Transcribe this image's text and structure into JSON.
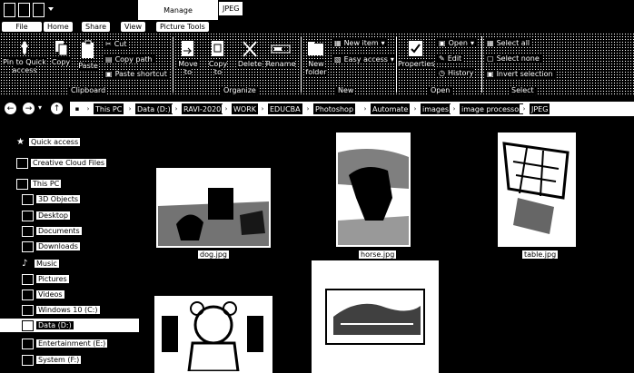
{
  "titlebar": {
    "manage_label": "Manage",
    "folder_title": "JPEG"
  },
  "ribbon_tabs": {
    "file": "File",
    "home": "Home",
    "share": "Share",
    "view": "View",
    "picture_tools": "Picture Tools"
  },
  "ribbon": {
    "pin_to_quick_access": "Pin to Quick access",
    "copy": "Copy",
    "paste": "Paste",
    "cut": "Cut",
    "copy_path": "Copy path",
    "paste_shortcut": "Paste shortcut",
    "move_to": "Move to",
    "copy_to": "Copy to",
    "delete": "Delete",
    "rename": "Rename",
    "new_folder": "New folder",
    "new_item": "New item",
    "easy_access": "Easy access",
    "properties": "Properties",
    "open": "Open",
    "edit": "Edit",
    "history": "History",
    "select_all": "Select all",
    "select_none": "Select none",
    "invert_selection": "Invert selection",
    "groups": {
      "clipboard": "Clipboard",
      "organize": "Organize",
      "new": "New",
      "open": "Open",
      "select": "Select"
    }
  },
  "address": {
    "crumbs": [
      "This PC",
      "Data (D:)",
      "RAVI-2020",
      "WORK",
      "EDUCBA",
      "Photoshop",
      "Automate",
      "images",
      "image processor",
      "JPEG"
    ]
  },
  "nav_pane": {
    "items": [
      {
        "label": "Quick access",
        "icon": "star-icon"
      },
      {
        "label": "Creative Cloud Files",
        "icon": "cloud-icon"
      },
      {
        "label": "This PC",
        "icon": "computer-icon"
      },
      {
        "label": "3D Objects",
        "icon": "cube-icon"
      },
      {
        "label": "Desktop",
        "icon": "desktop-icon"
      },
      {
        "label": "Documents",
        "icon": "document-icon"
      },
      {
        "label": "Downloads",
        "icon": "download-icon"
      },
      {
        "label": "Music",
        "icon": "music-icon"
      },
      {
        "label": "Pictures",
        "icon": "pictures-icon"
      },
      {
        "label": "Videos",
        "icon": "video-icon"
      },
      {
        "label": "Windows 10 (C:)",
        "icon": "drive-icon"
      },
      {
        "label": "Data (D:)",
        "icon": "drive-icon"
      },
      {
        "label": "Entertainment (E:)",
        "icon": "drive-icon"
      },
      {
        "label": "System (F:)",
        "icon": "drive-icon"
      }
    ]
  },
  "files": [
    {
      "name": "dog.jpg"
    },
    {
      "name": "horse.jpg"
    },
    {
      "name": "table.jpg"
    },
    {
      "name": ""
    },
    {
      "name": ""
    }
  ]
}
